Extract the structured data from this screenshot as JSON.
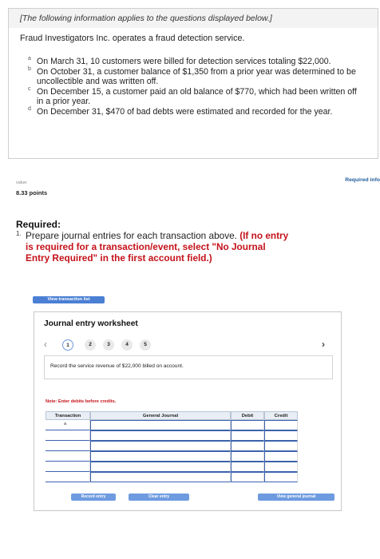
{
  "info": {
    "header": "[The following information applies to the questions displayed below.]",
    "company": "Fraud Investigators Inc. operates a fraud detection service.",
    "transactions": [
      {
        "marker": "a",
        "text": "On March 31, 10 customers were billed for detection services totaling $22,000."
      },
      {
        "marker": "b",
        "text": "On October 31, a customer balance of $1,350 from a prior year was determined to be uncollectible and was written off."
      },
      {
        "marker": "c",
        "text": "On December 15, a customer paid an old balance of $770, which had been written off in a prior year."
      },
      {
        "marker": "d",
        "text": "On December 31, $470 of bad debts were estimated and recorded for the year."
      }
    ]
  },
  "score": {
    "value_label": "value:",
    "points": "8.33 points"
  },
  "required_info": "Required info",
  "required": {
    "title": "Required:",
    "marker": "1.",
    "text": "Prepare journal entries for each transaction above. ",
    "note": "(If no entry is required for a transaction/event, select \"No Journal Entry Required\" in the first account field.)"
  },
  "view_transaction_list": "View transaction list",
  "worksheet": {
    "title": "Journal entry worksheet",
    "steps": [
      "1",
      "2",
      "3",
      "4",
      "5"
    ],
    "active_step": 1,
    "instruction": "Record the service revenue of $22,000 billed on account.",
    "note": "Note: Enter debits before credits.",
    "columns": {
      "transaction": "Transaction",
      "general_journal": "General Journal",
      "debit": "Debit",
      "credit": "Credit"
    },
    "row_transaction": "a",
    "buttons": {
      "record": "Record entry",
      "clear": "Clear entry",
      "view_journal": "View general journal"
    }
  },
  "icons": {
    "prev": "chevron-left-icon",
    "next": "chevron-right-icon"
  }
}
